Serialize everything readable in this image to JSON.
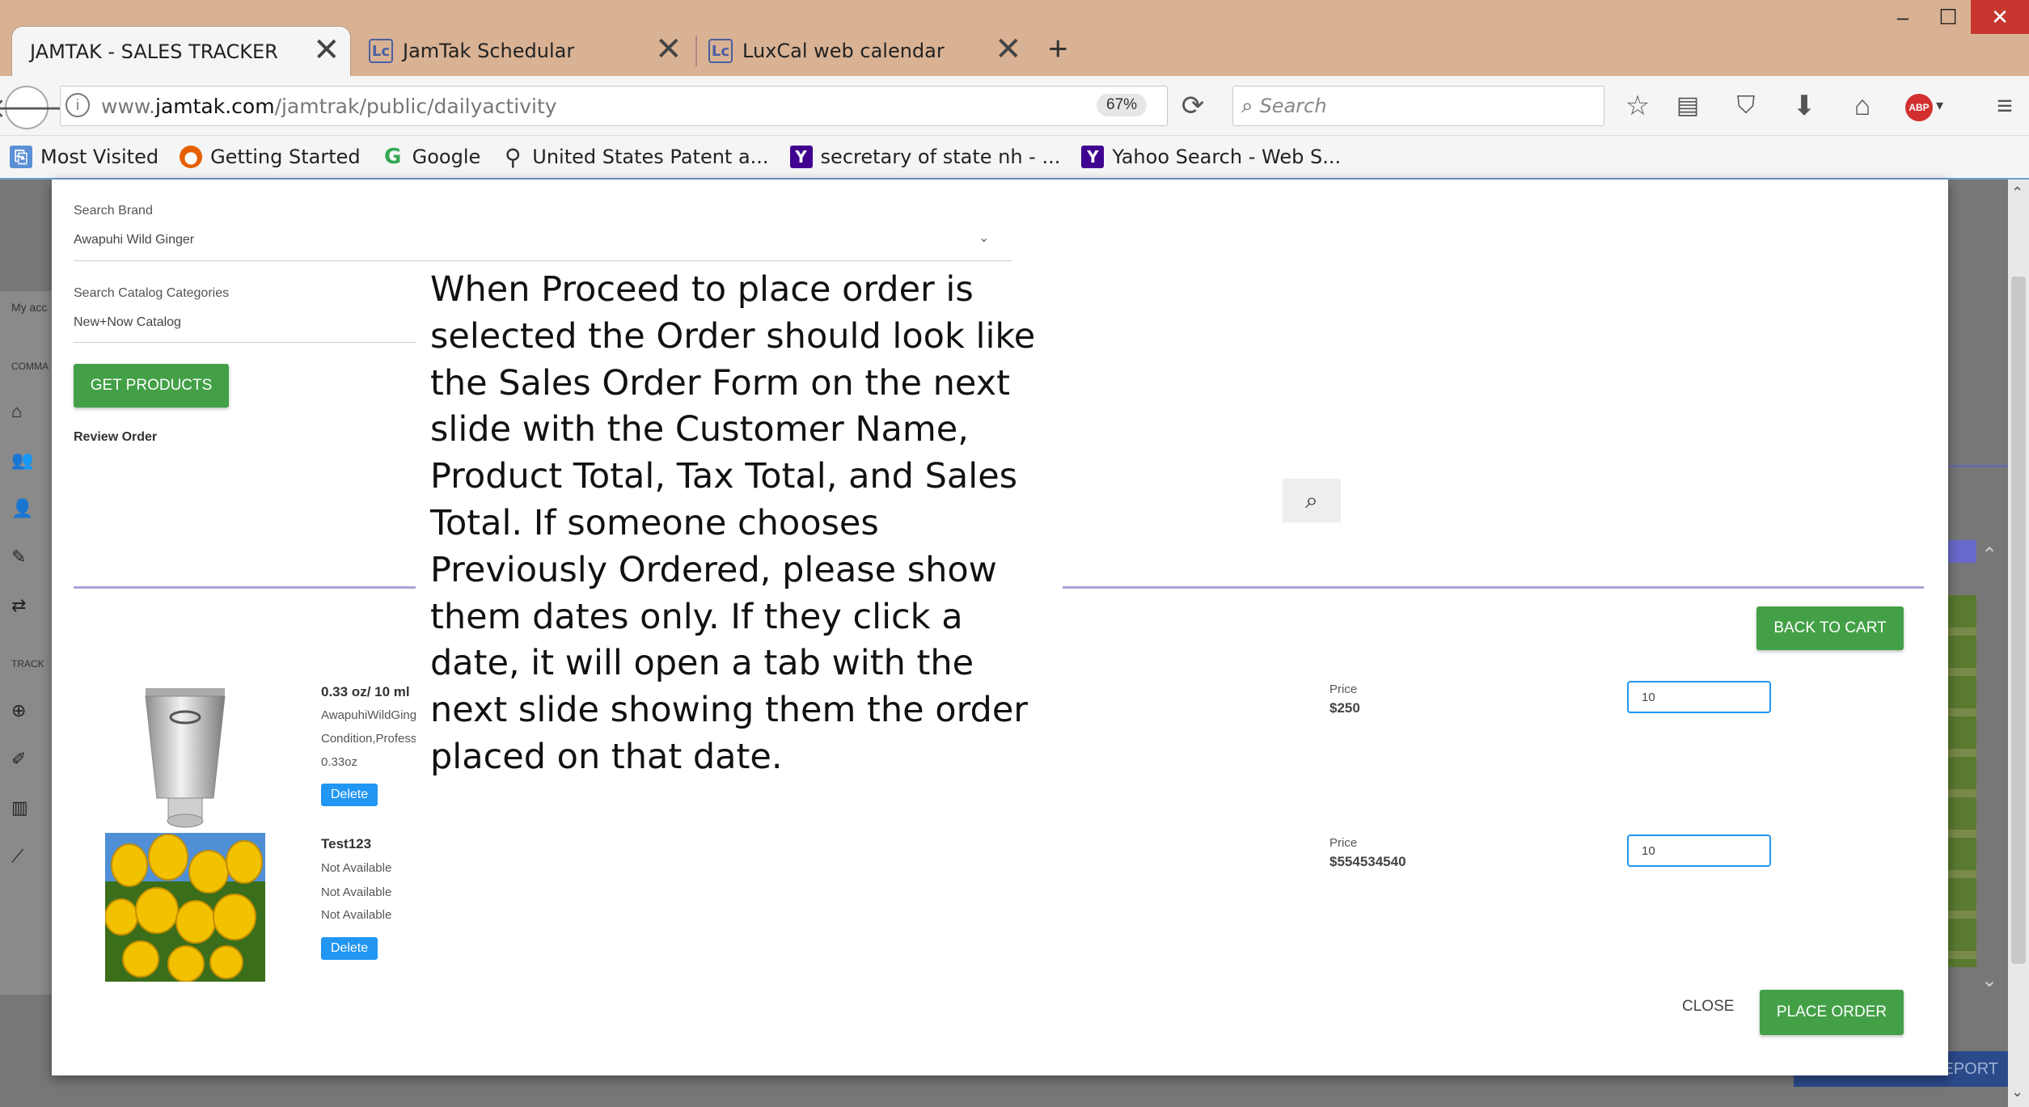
{
  "browser": {
    "tabs": [
      {
        "title": "JAMTAK - SALES TRACKER",
        "close": "✕"
      },
      {
        "title": "JamTak Schedular",
        "close": "✕",
        "icon": "Lc"
      },
      {
        "title": "LuxCal web calendar",
        "close": "✕",
        "icon": "Lc"
      }
    ],
    "new_tab": "+",
    "window": {
      "minimize": "‒",
      "maximize": "☐",
      "close": "✕"
    },
    "url_prefix": "www.",
    "url_domain": "jamtak.com",
    "url_path": "/jamtrak/public/dailyactivity",
    "zoom": "67%",
    "search_placeholder": "Search",
    "bookmarks": [
      "Most Visited",
      "Getting Started",
      "Google",
      "United States Patent a...",
      "secretary of state nh - ...",
      "Yahoo Search - Web S..."
    ],
    "abp": "ABP"
  },
  "sidebar": {
    "my_account": "My acc",
    "comm": "COMMA",
    "track": "TRACK"
  },
  "modal": {
    "search_brand_label": "Search Brand",
    "search_brand_value": "Awapuhi Wild Ginger",
    "catalog_label": "Search Catalog Categories",
    "catalog_value": "New+Now Catalog",
    "get_products": "GET PRODUCTS",
    "review_order": "Review Order",
    "back_to_cart": "BACK TO CART",
    "close": "CLOSE",
    "place_order": "PLACE ORDER",
    "items": [
      {
        "name": "0.33 oz/ 10 ml",
        "lines": [
          "AwapuhiWildGing",
          "Condition,Profess",
          "0.33oz"
        ],
        "price_label": "Price",
        "price": "$250",
        "qty": "10",
        "delete": "Delete"
      },
      {
        "name": "Test123",
        "lines": [
          "Not Available",
          "Not Available",
          "Not Available"
        ],
        "price_label": "Price",
        "price": "$554534540",
        "qty": "10",
        "delete": "Delete"
      }
    ]
  },
  "page_behind": {
    "report": "EPORT"
  },
  "annotation": "When Proceed to place order is selected the Order should look like the Sales Order Form on the next slide with the Customer Name, Product Total, Tax Total, and Sales Total. If someone chooses Previously Ordered, please show them dates only. If they click a date, it will open a tab with the next slide showing them the order placed on that date."
}
